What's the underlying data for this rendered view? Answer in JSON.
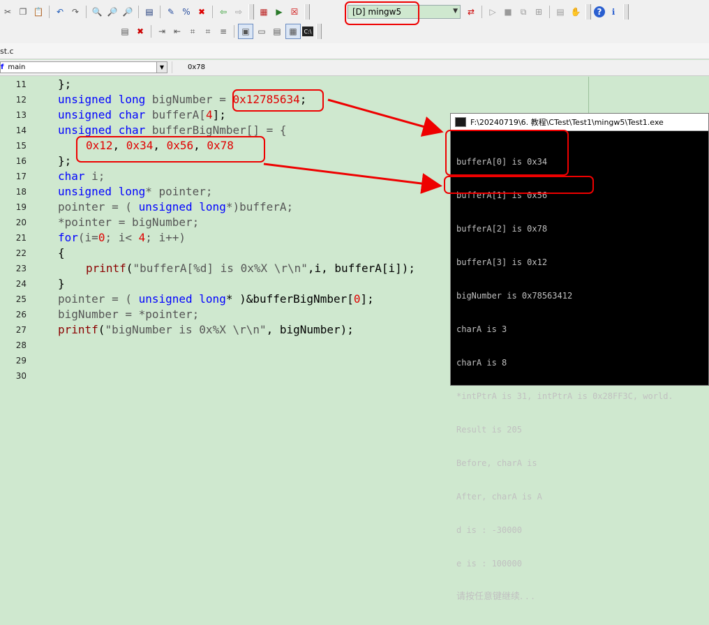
{
  "toolbar": {
    "config_label": "[D] mingw5"
  },
  "file_tab": {
    "label": "st.c"
  },
  "scope_bar": {
    "scope_value": "main",
    "address_value": "0x78"
  },
  "editor": {
    "lines": [
      {
        "n": "11"
      },
      {
        "n": "12"
      },
      {
        "n": "13"
      },
      {
        "n": "14"
      },
      {
        "n": "15"
      },
      {
        "n": "16"
      },
      {
        "n": "17"
      },
      {
        "n": "18"
      },
      {
        "n": "19"
      },
      {
        "n": "20"
      },
      {
        "n": "21"
      },
      {
        "n": "22"
      },
      {
        "n": "23"
      },
      {
        "n": "24"
      },
      {
        "n": "25"
      },
      {
        "n": "26"
      },
      {
        "n": "27"
      },
      {
        "n": "28"
      },
      {
        "n": "29"
      },
      {
        "n": "30"
      }
    ],
    "code": {
      "l11": "};",
      "l12_kw": "unsigned long",
      "l12_id": " bigNumber = ",
      "l12_num": "0x12785634",
      "l12_end": ";",
      "l13_kw": "unsigned char",
      "l13_id": " bufferA[",
      "l13_num": "4",
      "l13_end": "];",
      "l14_kw": "unsigned char",
      "l14_id": " bufferBigNmber[] = {",
      "l15_a": "0x12",
      "l15_b": "0x34",
      "l15_c": "0x56",
      "l15_d": "0x78",
      "l15_sep": ", ",
      "l16": "};",
      "l17_kw": "char",
      "l17_id": " i;",
      "l18_kw": "unsigned long",
      "l18_id": "* pointer;",
      "l19_a": "pointer = ( ",
      "l19_kw": "unsigned long",
      "l19_b": "*)bufferA;",
      "l20": "*pointer = bigNumber;",
      "l21_kw": "for",
      "l21_a": "(i=",
      "l21_n0": "0",
      "l21_b": "; i< ",
      "l21_n4": "4",
      "l21_c": "; i++)",
      "l22": "{",
      "l23_fn": "printf",
      "l23_a": "(",
      "l23_str": "\"bufferA[%d] is 0x%X \\r\\n\"",
      "l23_b": ",i, bufferA[i]);",
      "l24": "}",
      "l25_a": "pointer = ( ",
      "l25_kw": "unsigned long",
      "l25_b": "* )&bufferBigNmber[",
      "l25_n": "0",
      "l25_c": "];",
      "l26": "bigNumber = *pointer;",
      "l27_fn": "printf",
      "l27_a": "(",
      "l27_str": "\"bigNumber is 0x%X \\r\\n\"",
      "l27_b": ", bigNumber);"
    }
  },
  "console": {
    "title": "F:\\20240719\\6. 教程\\CTest\\Test1\\mingw5\\Test1.exe",
    "output": [
      "bufferA[0] is 0x34",
      "bufferA[1] is 0x56",
      "bufferA[2] is 0x78",
      "bufferA[3] is 0x12",
      "bigNumber is 0x78563412",
      "charA is 3",
      "charA is 8",
      "*intPtrA is 31, intPtrA is 0x28FF3C, world.",
      "Result is 205",
      "Before, charA is",
      "After, charA is A",
      "d is : -30000",
      "e is : 100000",
      "请按任意键继续. . ."
    ]
  },
  "colors": {
    "editor_bg": "#cfe8cf",
    "keyword": "#0000ff",
    "number": "#e00000",
    "annotation": "#e00000"
  }
}
